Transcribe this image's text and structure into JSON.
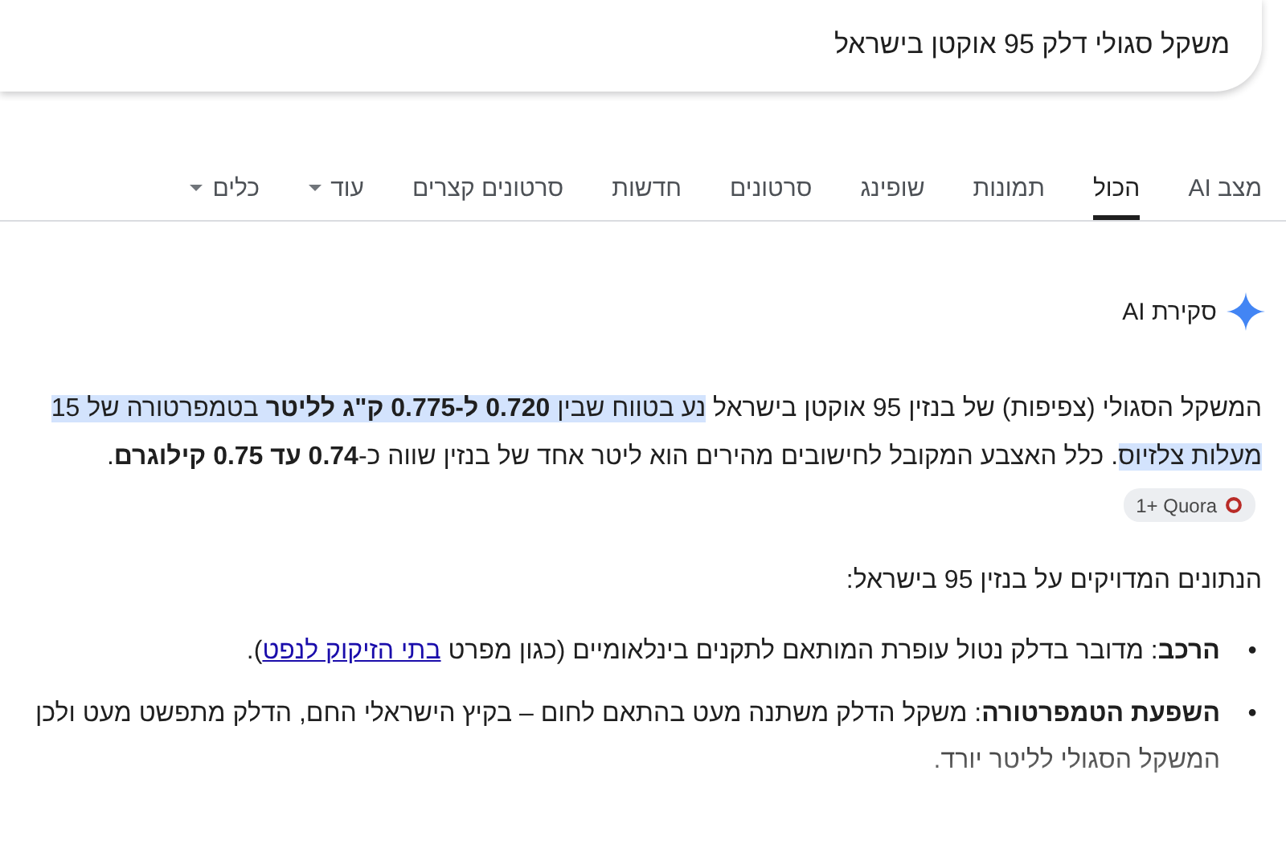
{
  "search": {
    "value": "משקל סגולי דלק 95 אוקטן בישראל"
  },
  "tabs": [
    {
      "label": "מצב AI",
      "selected": false,
      "has_menu": false
    },
    {
      "label": "הכול",
      "selected": true,
      "has_menu": false
    },
    {
      "label": "תמונות",
      "selected": false,
      "has_menu": false
    },
    {
      "label": "שופינג",
      "selected": false,
      "has_menu": false
    },
    {
      "label": "סרטונים",
      "selected": false,
      "has_menu": false
    },
    {
      "label": "חדשות",
      "selected": false,
      "has_menu": false
    },
    {
      "label": "סרטונים קצרים",
      "selected": false,
      "has_menu": false
    },
    {
      "label": "עוד",
      "selected": false,
      "has_menu": true
    },
    {
      "label": "כלים",
      "selected": false,
      "has_menu": true
    }
  ],
  "ai_overview": {
    "title": "סקירת AI",
    "paragraph": [
      {
        "text": "המשקל הסגולי (צפיפות) של בנזין 95 אוקטן בישראל ",
        "highlighted": false
      },
      {
        "text": "נע בטווח שבין **0.720 ל-0.775 ק\"ג לליטר** בטמפרטורה של 15 מעלות צלזיוס",
        "highlighted": true
      },
      {
        "text": ". כלל האצבע המקובל לחישובים מהירים הוא ליטר אחד של בנזין שווה כ-**0.74 עד 0.75 קילוגרם**.",
        "highlighted": false
      }
    ],
    "source_chip": {
      "label": "1+ Quora"
    },
    "intro": "הנתונים המדויקים על בנזין 95 בישראל:",
    "bullets": [
      {
        "marker": "•",
        "text": "**הרכב**: מדובר בדלק נטול עופרת המותאם לתקנים בינלאומיים (כגון מפרט ",
        "link": "בתי הזיקוק לנפט",
        "after": ").",
        "faded": false
      },
      {
        "marker": "•",
        "text": "**השפעת הטמפרטורה**: משקל הדלק משתנה מעט בהתאם לחום – בקיץ הישראלי החם, הדלק מתפשט מעט ולכן המשקל הסגולי לליטר יורד.",
        "faded": true
      }
    ]
  }
}
